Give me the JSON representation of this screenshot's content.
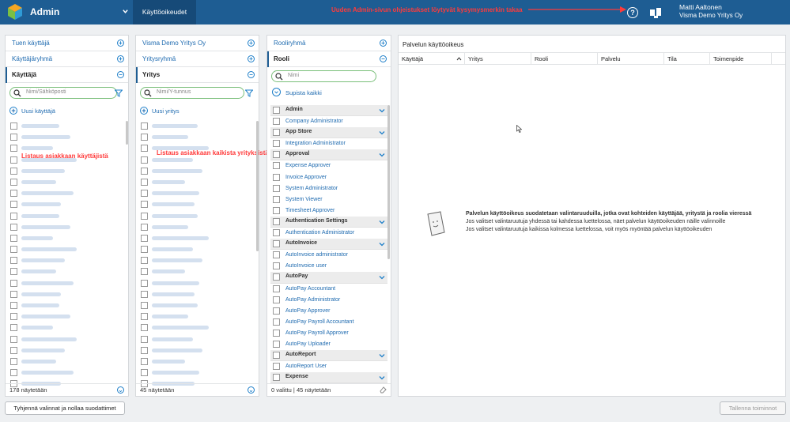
{
  "header": {
    "app_title": "Admin",
    "nav_tab": "Käyttöoikeudet",
    "annotation": "Uuden Admin-sivun ohjeistukset löytyvät kysymysmerkin takaa",
    "help_symbol": "?",
    "user_name": "Matti Aaltonen",
    "user_company": "Visma Demo Yritys Oy",
    "bg_color": "#1e5d93"
  },
  "panel_users": {
    "accordion": [
      {
        "label": "Tuen käyttäjä",
        "icon": "plus-circle-icon"
      },
      {
        "label": "Käyttäjäryhmä",
        "icon": "plus-circle-icon"
      },
      {
        "label": "Käyttäjä",
        "icon": "minus-circle-icon"
      }
    ],
    "search_placeholder": "Nimi/Sähköposti",
    "new_label": "Uusi käyttäjä",
    "annotation": "Listaus asiakkaan käyttäjistä",
    "footer": "178 näytetään"
  },
  "panel_companies": {
    "accordion": [
      {
        "label": "Visma Demo Yritys Oy",
        "icon": "plus-circle-icon"
      },
      {
        "label": "Yritysryhmä",
        "icon": "plus-circle-icon"
      },
      {
        "label": "Yritys",
        "icon": "minus-circle-icon"
      }
    ],
    "search_placeholder": "Nimi/Y-tunnus",
    "new_label": "Uusi yritys",
    "annotation": "Listaus asiakkaan kaikista yrityksistä",
    "footer": "45 näytetään"
  },
  "panel_roles": {
    "accordion": [
      {
        "label": "Rooliryhmä",
        "icon": "plus-circle-icon"
      },
      {
        "label": "Rooli",
        "icon": "minus-circle-icon"
      }
    ],
    "search_placeholder": "Nimi",
    "collapse_label": "Supista kaikki",
    "groups": [
      {
        "name": "Admin",
        "roles": [
          "Company Administrator"
        ]
      },
      {
        "name": "App Store",
        "roles": [
          "Integration Administrator"
        ]
      },
      {
        "name": "Approval",
        "roles": [
          "Expense Approver",
          "Invoice Approver",
          "System Administrator",
          "System Viewer",
          "Timesheet Approver"
        ]
      },
      {
        "name": "Authentication Settings",
        "roles": [
          "Authentication Administrator"
        ]
      },
      {
        "name": "AutoInvoice",
        "roles": [
          "AutoInvoice administrator",
          "AutoInvoice user"
        ]
      },
      {
        "name": "AutoPay",
        "roles": [
          "AutoPay Accountant",
          "AutoPay Administrator",
          "AutoPay Approver",
          "AutoPay Payroll Accountant",
          "AutoPay Payroll Approver",
          "AutoPay Uploader"
        ]
      },
      {
        "name": "AutoReport",
        "roles": [
          "AutoReport User"
        ]
      },
      {
        "name": "Expense",
        "roles": []
      }
    ],
    "footer": "0 valittu | 45 näytetään"
  },
  "panel_results": {
    "title": "Palvelun käyttöoikeus",
    "columns": [
      "Käyttäjä",
      "Yritys",
      "Rooli",
      "Palvelu",
      "Tila",
      "Toimenpide"
    ],
    "empty_title": "Palvelun käyttöoikeus suodatetaan valintaruuduilla, jotka ovat kohteiden käyttäjää, yritystä ja roolia vieressä",
    "empty_line1": "Jos valitset valintaruutuja yhdessä tai kahdessa luettelossa, näet palvelun käyttöoikeuden näille valinnoille",
    "empty_line2": "Jos valitset valintaruutuja kaikissa kolmessa luettelossa, voit myös myöntää palvelun käyttöoikeuden"
  },
  "buttons": {
    "reset": "Tyhjennä valinnat ja nollaa suodattimet",
    "save": "Tallenna toiminnot"
  }
}
